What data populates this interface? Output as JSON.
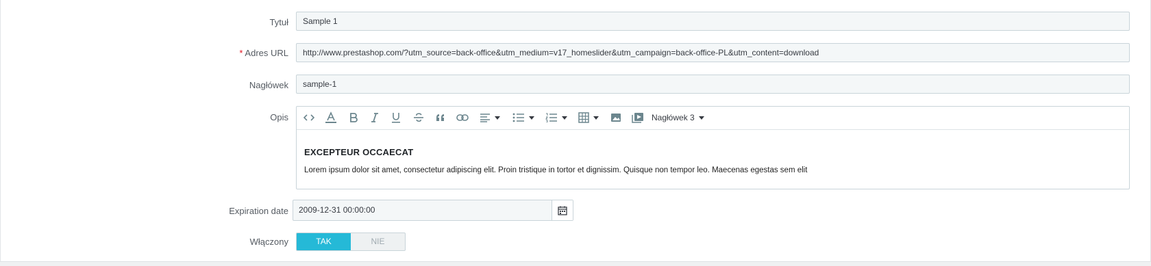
{
  "form": {
    "title": {
      "label": "Tytuł",
      "value": "Sample 1"
    },
    "url": {
      "required_mark": "*",
      "label": "Adres URL",
      "value": "http://www.prestashop.com/?utm_source=back-office&utm_medium=v17_homeslider&utm_campaign=back-office-PL&utm_content=download"
    },
    "legend": {
      "label": "Nagłówek",
      "value": "sample-1"
    },
    "description": {
      "label": "Opis",
      "heading_select": "Nagłówek 3",
      "content_heading": "EXCEPTEUR OCCAECAT",
      "content_paragraph": "Lorem ipsum dolor sit amet, consectetur adipiscing elit. Proin tristique in tortor et dignissim. Quisque non tempor leo. Maecenas egestas sem elit"
    },
    "expiration": {
      "label": "Expiration date",
      "value": "2009-12-31 00:00:00"
    },
    "enabled": {
      "label": "Włączony",
      "yes": "TAK",
      "no": "NIE",
      "selected": "TAK"
    }
  },
  "toolbar_icons": [
    "code-view-icon",
    "font-color-icon",
    "bold-icon",
    "italic-icon",
    "underline-icon",
    "strikethrough-icon",
    "blockquote-icon",
    "link-icon",
    "align-icon",
    "unordered-list-icon",
    "ordered-list-icon",
    "table-icon",
    "image-icon",
    "video-icon"
  ],
  "colors": {
    "accent": "#25b9d7",
    "required": "#e2131f",
    "field_bg": "#f4f7f8"
  }
}
